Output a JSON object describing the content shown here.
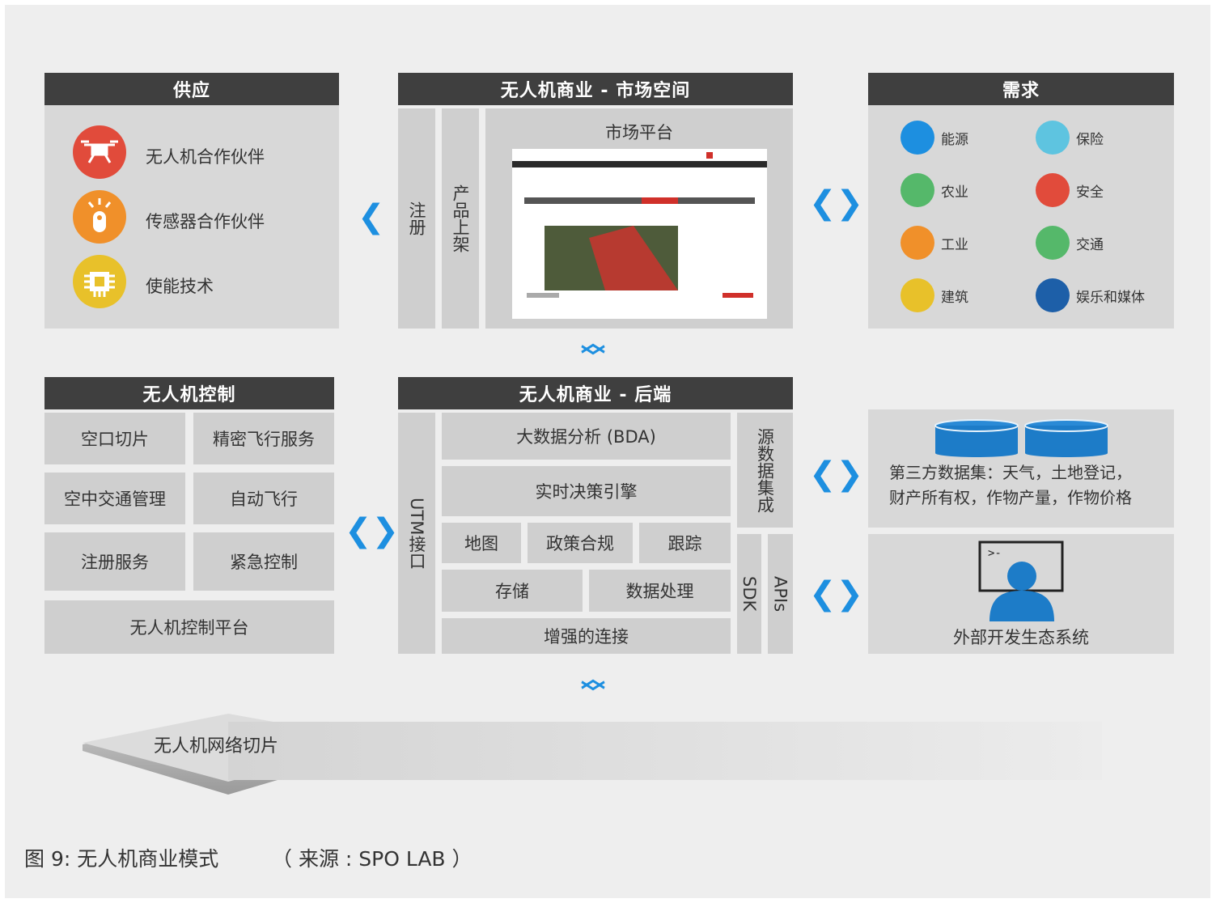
{
  "supply": {
    "title": "供应",
    "items": [
      {
        "label": "无人机合作伙伴",
        "icon": "drone-icon",
        "color": "#e14b3b"
      },
      {
        "label": "传感器合作伙伴",
        "icon": "sensor-icon",
        "color": "#f0902a"
      },
      {
        "label": "使能技术",
        "icon": "chip-icon",
        "color": "#e8c12a"
      }
    ]
  },
  "market": {
    "title": "无人机商业 - 市场空间",
    "register": "注册",
    "listing": "产品上架",
    "platform": "市场平台"
  },
  "demand": {
    "title": "需求",
    "items": [
      {
        "label": "能源",
        "icon": "wind-turbine-icon",
        "color": "#1d8fe0"
      },
      {
        "label": "保险",
        "icon": "shield-icon",
        "color": "#5ec4e0"
      },
      {
        "label": "农业",
        "icon": "tractor-icon",
        "color": "#55b86a"
      },
      {
        "label": "安全",
        "icon": "camera-icon",
        "color": "#e14b3b"
      },
      {
        "label": "工业",
        "icon": "factory-icon",
        "color": "#f0902a"
      },
      {
        "label": "交通",
        "icon": "train-icon",
        "color": "#55b86a"
      },
      {
        "label": "建筑",
        "icon": "cone-icon",
        "color": "#e8c12a"
      },
      {
        "label": "娱乐和媒体",
        "icon": "film-icon",
        "color": "#1d5fa8"
      }
    ]
  },
  "control": {
    "title": "无人机控制",
    "cells": [
      "空口切片",
      "精密飞行服务",
      "空中交通管理",
      "自动飞行",
      "注册服务",
      "紧急控制"
    ],
    "platform": "无人机控制平台"
  },
  "backend": {
    "title": "无人机商业 - 后端",
    "utm": "UTM接口",
    "bda": "大数据分析 (BDA)",
    "decision": "实时决策引擎",
    "map": "地图",
    "policy": "政策合规",
    "track": "跟踪",
    "storage": "存储",
    "processing": "数据处理",
    "connect": "增强的连接",
    "source": "源数据集成",
    "sdk": "SDK",
    "apis": "APIs"
  },
  "third_party": {
    "text_line1": "第三方数据集：天气，土地登记，",
    "text_line2": "财产所有权，作物产量，作物价格"
  },
  "ecosystem": {
    "label": "外部开发生态系统",
    "prompt": ">-"
  },
  "slice": {
    "label": "无人机网络切片"
  },
  "caption": {
    "figure": "图 9: 无人机商业模式",
    "source": "（ 来源 : SPO LAB ）"
  },
  "colors": {
    "accent": "#1d8fe0",
    "header": "#3f3f3f",
    "panel": "#d8d8d8"
  }
}
